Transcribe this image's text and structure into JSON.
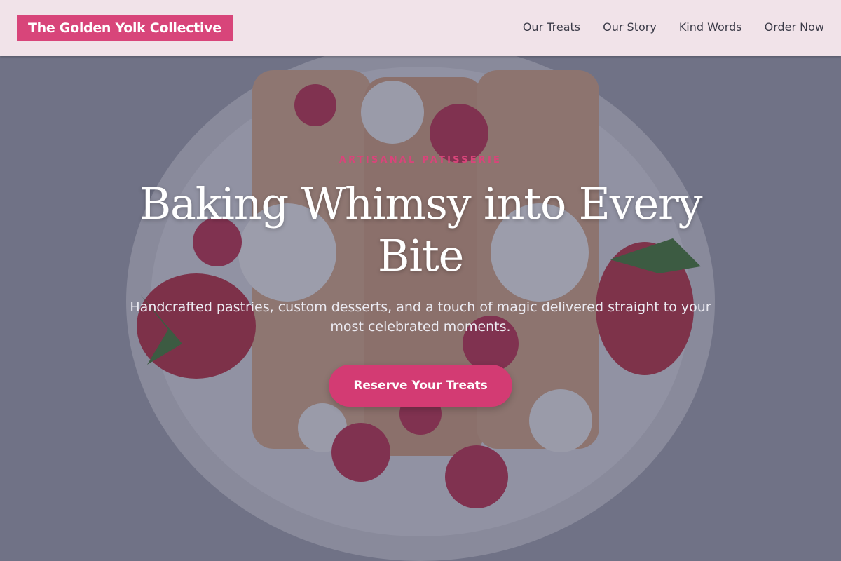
{
  "brand": {
    "name": "The Golden Yolk Collective"
  },
  "nav": {
    "items": [
      {
        "label": "Our Treats"
      },
      {
        "label": "Our Story"
      },
      {
        "label": "Kind Words"
      },
      {
        "label": "Order Now"
      }
    ]
  },
  "hero": {
    "eyebrow": "ARTISANAL PATISSERIE",
    "headline": "Baking Whimsy into Every Bite",
    "subheadline": "Handcrafted pastries, custom desserts, and a touch of magic delivered straight to your most celebrated moments.",
    "cta_label": "Reserve Your Treats"
  },
  "colors": {
    "accent": "#d8457a",
    "header_background": "#f1e3e9",
    "overlay": "#3a3c58"
  }
}
